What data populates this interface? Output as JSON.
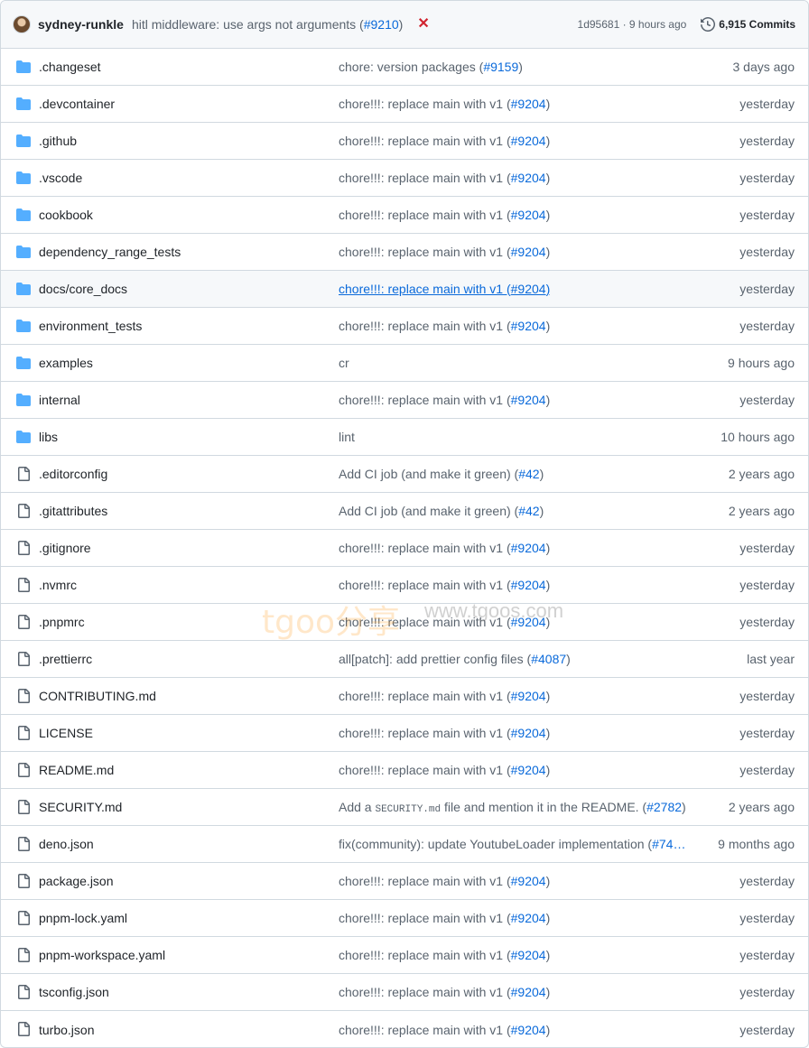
{
  "header": {
    "author": "sydney-runkle",
    "message": "hitl middleware: use args not arguments (",
    "pr": "#9210",
    "message_end": ")",
    "status_icon": "x-icon",
    "sha_time": "1d95681 · 9 hours ago",
    "commits": "6,915 Commits"
  },
  "rows": [
    {
      "type": "folder",
      "name": ".changeset",
      "msg": "chore: version packages (",
      "pr": "#9159",
      "end": ")",
      "time": "3 days ago"
    },
    {
      "type": "folder",
      "name": ".devcontainer",
      "msg": "chore!!!: replace main with v1 (",
      "pr": "#9204",
      "end": ")",
      "time": "yesterday"
    },
    {
      "type": "folder",
      "name": ".github",
      "msg": "chore!!!: replace main with v1 (",
      "pr": "#9204",
      "end": ")",
      "time": "yesterday"
    },
    {
      "type": "folder",
      "name": ".vscode",
      "msg": "chore!!!: replace main with v1 (",
      "pr": "#9204",
      "end": ")",
      "time": "yesterday"
    },
    {
      "type": "folder",
      "name": "cookbook",
      "msg": "chore!!!: replace main with v1 (",
      "pr": "#9204",
      "end": ")",
      "time": "yesterday"
    },
    {
      "type": "folder",
      "name": "dependency_range_tests",
      "msg": "chore!!!: replace main with v1 (",
      "pr": "#9204",
      "end": ")",
      "time": "yesterday"
    },
    {
      "type": "folder",
      "name": "docs/core_docs",
      "msg": "chore!!!: replace main with v1 (",
      "pr": "#9204",
      "end": ")",
      "time": "yesterday",
      "hover": true
    },
    {
      "type": "folder",
      "name": "environment_tests",
      "msg": "chore!!!: replace main with v1 (",
      "pr": "#9204",
      "end": ")",
      "time": "yesterday"
    },
    {
      "type": "folder",
      "name": "examples",
      "msg": "cr",
      "pr": "",
      "end": "",
      "time": "9 hours ago"
    },
    {
      "type": "folder",
      "name": "internal",
      "msg": "chore!!!: replace main with v1 (",
      "pr": "#9204",
      "end": ")",
      "time": "yesterday"
    },
    {
      "type": "folder",
      "name": "libs",
      "msg": "lint",
      "pr": "",
      "end": "",
      "time": "10 hours ago"
    },
    {
      "type": "file",
      "name": ".editorconfig",
      "msg": "Add CI job (and make it green) (",
      "pr": "#42",
      "end": ")",
      "time": "2 years ago"
    },
    {
      "type": "file",
      "name": ".gitattributes",
      "msg": "Add CI job (and make it green) (",
      "pr": "#42",
      "end": ")",
      "time": "2 years ago"
    },
    {
      "type": "file",
      "name": ".gitignore",
      "msg": "chore!!!: replace main with v1 (",
      "pr": "#9204",
      "end": ")",
      "time": "yesterday"
    },
    {
      "type": "file",
      "name": ".nvmrc",
      "msg": "chore!!!: replace main with v1 (",
      "pr": "#9204",
      "end": ")",
      "time": "yesterday"
    },
    {
      "type": "file",
      "name": ".pnpmrc",
      "msg": "chore!!!: replace main with v1 (",
      "pr": "#9204",
      "end": ")",
      "time": "yesterday"
    },
    {
      "type": "file",
      "name": ".prettierrc",
      "msg": "all[patch]: add prettier config files (",
      "pr": "#4087",
      "end": ")",
      "time": "last year"
    },
    {
      "type": "file",
      "name": "CONTRIBUTING.md",
      "msg": "chore!!!: replace main with v1 (",
      "pr": "#9204",
      "end": ")",
      "time": "yesterday"
    },
    {
      "type": "file",
      "name": "LICENSE",
      "msg": "chore!!!: replace main with v1 (",
      "pr": "#9204",
      "end": ")",
      "time": "yesterday"
    },
    {
      "type": "file",
      "name": "README.md",
      "msg": "chore!!!: replace main with v1 (",
      "pr": "#9204",
      "end": ")",
      "time": "yesterday"
    },
    {
      "type": "file",
      "name": "SECURITY.md",
      "msg": "Add a ",
      "code": "SECURITY.md",
      "msg2": " file and mention it in the README. (",
      "pr": "#2782",
      "end": ")",
      "time": "2 years ago"
    },
    {
      "type": "file",
      "name": "deno.json",
      "msg": "fix(community): update YoutubeLoader implementation (",
      "pr": "#74…",
      "end": "",
      "time": "9 months ago"
    },
    {
      "type": "file",
      "name": "package.json",
      "msg": "chore!!!: replace main with v1 (",
      "pr": "#9204",
      "end": ")",
      "time": "yesterday"
    },
    {
      "type": "file",
      "name": "pnpm-lock.yaml",
      "msg": "chore!!!: replace main with v1 (",
      "pr": "#9204",
      "end": ")",
      "time": "yesterday"
    },
    {
      "type": "file",
      "name": "pnpm-workspace.yaml",
      "msg": "chore!!!: replace main with v1 (",
      "pr": "#9204",
      "end": ")",
      "time": "yesterday"
    },
    {
      "type": "file",
      "name": "tsconfig.json",
      "msg": "chore!!!: replace main with v1 (",
      "pr": "#9204",
      "end": ")",
      "time": "yesterday"
    },
    {
      "type": "file",
      "name": "turbo.json",
      "msg": "chore!!!: replace main with v1 (",
      "pr": "#9204",
      "end": ")",
      "time": "yesterday"
    }
  ],
  "watermark": {
    "text1": "tgoo分享",
    "text2": "www.tgoos.com"
  },
  "colors": {
    "folder": "#54aeff",
    "file": "#59636e",
    "link": "#0969da",
    "danger": "#d1242f"
  }
}
